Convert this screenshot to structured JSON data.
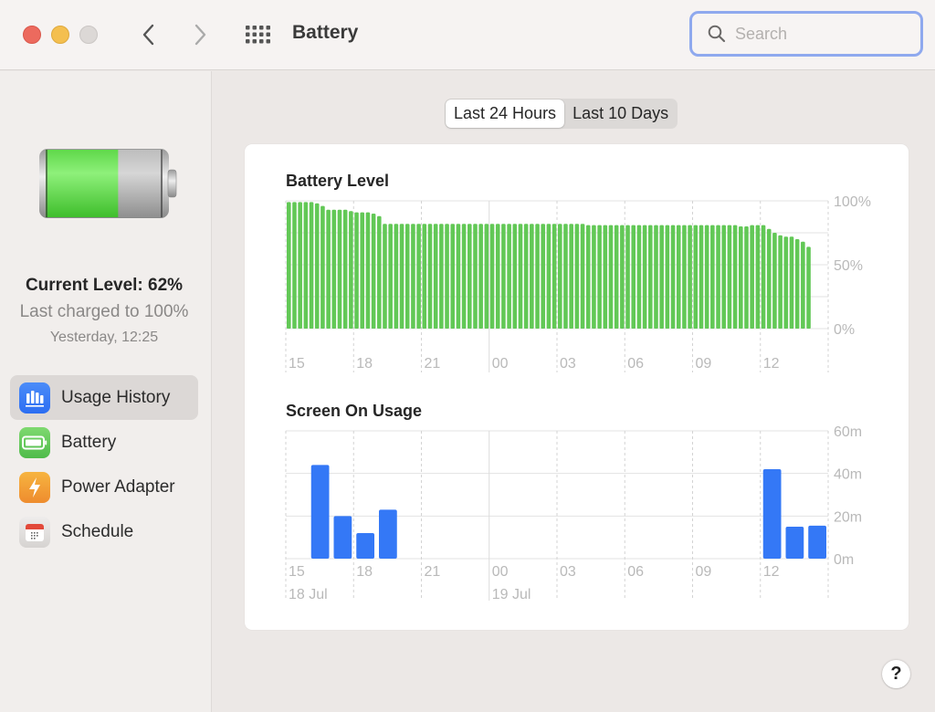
{
  "window": {
    "title": "Battery",
    "search_placeholder": "Search",
    "search_value": ""
  },
  "sidebar": {
    "current_level": "Current Level: 62%",
    "current_level_fraction": 0.62,
    "last_charged": "Last charged to 100%",
    "charged_time": "Yesterday, 12:25",
    "items": [
      {
        "label": "Usage History",
        "icon": "usage-history-icon",
        "active": true,
        "color": "#3478f6"
      },
      {
        "label": "Battery",
        "icon": "battery-icon",
        "active": false,
        "color": "#5fc45f"
      },
      {
        "label": "Power Adapter",
        "icon": "power-adapter-icon",
        "active": false,
        "color": "#f19a35"
      },
      {
        "label": "Schedule",
        "icon": "schedule-icon",
        "active": false,
        "color": "#e4e1df"
      }
    ]
  },
  "range_tabs": [
    {
      "label": "Last 24 Hours",
      "active": true
    },
    {
      "label": "Last 10 Days",
      "active": false
    }
  ],
  "help_label": "?",
  "chart_data": [
    {
      "type": "bar",
      "title": "Battery Level",
      "color": "#62c856",
      "ylim": [
        0,
        100
      ],
      "y_ticks": [
        "0%",
        "50%",
        "100%"
      ],
      "y_gridlines": [
        0,
        25,
        50,
        75,
        100
      ],
      "x_tick_labels": [
        "15",
        "18",
        "21",
        "00",
        "03",
        "06",
        "09",
        "12"
      ],
      "interval": "15 minutes",
      "start_hour": 15,
      "values": [
        99,
        99,
        99,
        99,
        99,
        98,
        96,
        93,
        93,
        93,
        93,
        92,
        91,
        91,
        91,
        90,
        88,
        82,
        82,
        82,
        82,
        82,
        82,
        82,
        82,
        82,
        82,
        82,
        82,
        82,
        82,
        82,
        82,
        82,
        82,
        82,
        82,
        82,
        82,
        82,
        82,
        82,
        82,
        82,
        82,
        82,
        82,
        82,
        82,
        82,
        82,
        82,
        82,
        81,
        81,
        81,
        81,
        81,
        81,
        81,
        81,
        81,
        81,
        81,
        81,
        81,
        81,
        81,
        81,
        81,
        81,
        81,
        81,
        81,
        81,
        81,
        81,
        81,
        81,
        81,
        80,
        80,
        81,
        81,
        81,
        78,
        75,
        73,
        72,
        72,
        70,
        68,
        64
      ]
    },
    {
      "type": "bar",
      "title": "Screen On Usage",
      "color": "#3478f6",
      "ylim": [
        0,
        60
      ],
      "unit": "minutes",
      "y_ticks": [
        "0m",
        "20m",
        "40m",
        "60m"
      ],
      "x_tick_labels": [
        "15",
        "18",
        "21",
        "00",
        "03",
        "06",
        "09",
        "12"
      ],
      "date_labels": [
        {
          "label": "18 Jul",
          "at": "15"
        },
        {
          "label": "19 Jul",
          "at": "00"
        }
      ],
      "categories": [
        "15",
        "16",
        "17",
        "18",
        "19",
        "20",
        "21",
        "22",
        "23",
        "00",
        "01",
        "02",
        "03",
        "04",
        "05",
        "06",
        "07",
        "08",
        "09",
        "10",
        "11",
        "12",
        "13",
        "14"
      ],
      "values": [
        0,
        44,
        20,
        12,
        23,
        0,
        0,
        0,
        0,
        0,
        0,
        0,
        0,
        0,
        0,
        0,
        0,
        0,
        0,
        0,
        0,
        42,
        15,
        15.5
      ]
    }
  ]
}
